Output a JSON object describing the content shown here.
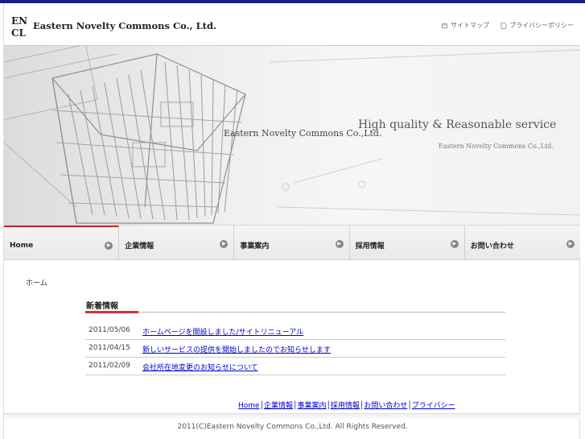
{
  "header": {
    "logo_letters": "ENCL",
    "company_name": "Eastern  Novelty  Commons  Co., Ltd.",
    "links": [
      {
        "icon": "sitemap-icon",
        "label": "サイトマップ"
      },
      {
        "icon": "document-icon",
        "label": "プライバシーポリシー"
      }
    ]
  },
  "hero": {
    "company_name": "Eastern Novelty Commons Co.,Ltd.",
    "tagline": "High quality & Reasonable service",
    "sub": "Eastern Novelty Commons Co.,Ltd."
  },
  "nav": {
    "items": [
      {
        "label": "Home",
        "active": true
      },
      {
        "label": "企業情報",
        "active": false
      },
      {
        "label": "事業案内",
        "active": false
      },
      {
        "label": "採用情報",
        "active": false
      },
      {
        "label": "お問い合わせ",
        "active": false
      }
    ]
  },
  "breadcrumb": "ホーム",
  "news": {
    "title": "新着情報",
    "items": [
      {
        "date": "2011/05/06",
        "text": "ホームページを開設しました/サイトリニューアル"
      },
      {
        "date": "2011/04/15",
        "text": "新しいサービスの提供を開始しましたのでお知らせします"
      },
      {
        "date": "2011/02/09",
        "text": "会社所在地変更のお知らせについて"
      }
    ]
  },
  "footer": {
    "links": [
      "Home",
      "企業情報",
      "事業案内",
      "採用情報",
      "お問い合わせ",
      "プライバシー"
    ],
    "copyright": "2011(C)Eastern Novelty Commons Co.,Ltd. All Rights Reserved."
  },
  "colors": {
    "topbar": "#1a1e8a",
    "nav_active": "#cc2222",
    "link": "#0000cc",
    "news_accent": "#cc3333"
  }
}
